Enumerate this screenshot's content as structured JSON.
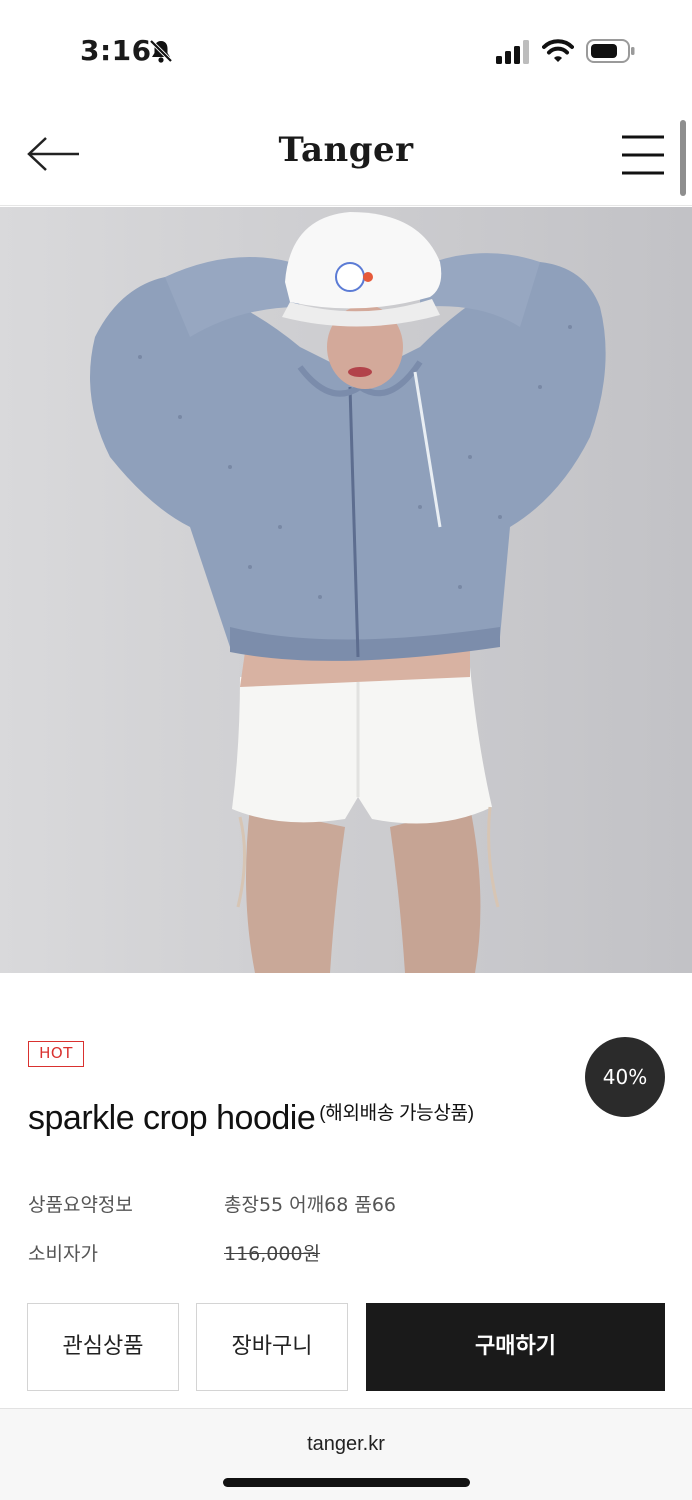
{
  "status_bar": {
    "time": "3:16",
    "icons": [
      "bell-slash-icon",
      "cellular-signal-icon",
      "wifi-icon",
      "battery-icon"
    ]
  },
  "header": {
    "brand": "Tanger",
    "back_icon": "arrow-left-icon",
    "menu_icon": "hamburger-menu-icon"
  },
  "product": {
    "badge": "HOT",
    "discount": "40%",
    "title": "sparkle crop hoodie",
    "title_suffix": "(해외배송 가능상품)",
    "summary_label": "상품요약정보",
    "summary_value": "총장55 어깨68 품66",
    "price_label": "소비자가",
    "price_value": "116,000원"
  },
  "actions": {
    "wishlist": "관심상품",
    "cart": "장바구니",
    "buy": "구매하기"
  },
  "browser": {
    "url": "tanger.kr"
  },
  "colors": {
    "hot_red": "#d9312f",
    "buy_button": "#1a1a1a",
    "discount_badge": "#2b2b2b"
  }
}
